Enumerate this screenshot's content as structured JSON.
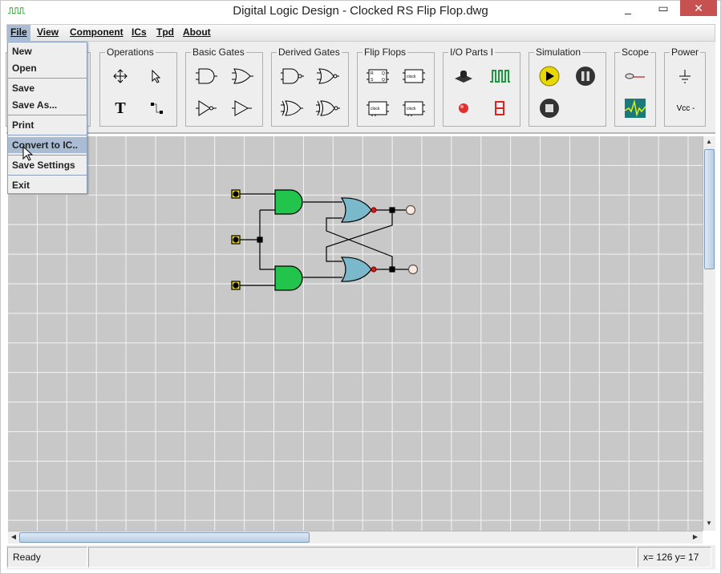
{
  "window": {
    "title": "Digital Logic Design - Clocked RS Flip Flop.dwg",
    "minimize": "—",
    "maximize": "□",
    "close": "✕",
    "app_icon": "clock-pulse-icon"
  },
  "menubar": [
    "File",
    "View",
    "Component",
    "ICs",
    "Tpd",
    "About"
  ],
  "file_menu": {
    "items": [
      "New",
      "Open",
      "Save",
      "Save As...",
      "Print",
      "Convert to IC..",
      "Save Settings",
      "Exit"
    ],
    "highlighted": "Convert to IC.."
  },
  "toolbar": {
    "groups": [
      {
        "label": "Operations",
        "tools": [
          "move-icon",
          "select-pointer-icon",
          "text-icon",
          "wire-icon"
        ]
      },
      {
        "label": "Basic Gates",
        "tools": [
          "and-gate-icon",
          "or-gate-icon",
          "not-gate-icon",
          "buffer-gate-icon"
        ]
      },
      {
        "label": "Derived Gates",
        "tools": [
          "nand-gate-icon",
          "nor-gate-icon",
          "xor-gate-icon",
          "xnor-gate-icon"
        ]
      },
      {
        "label": "Flip Flops",
        "tools": [
          "rs-flipflop-icon",
          "jk-flipflop-icon",
          "d-flipflop-icon",
          "t-flipflop-icon"
        ]
      },
      {
        "label": "I/O Parts I",
        "tools": [
          "push-button-icon",
          "clock-icon",
          "led-icon",
          "seven-segment-icon"
        ]
      },
      {
        "label": "Simulation",
        "tools": [
          "play-icon",
          "pause-icon",
          "stop-icon"
        ]
      },
      {
        "label": "Scope",
        "tools": [
          "probe-icon",
          "oscilloscope-icon"
        ]
      },
      {
        "label": "Power",
        "tools": [
          "ground-icon",
          "vcc-icon"
        ],
        "vcc_label": "Vcc -"
      }
    ]
  },
  "colors": {
    "and_gate": "#22c44c",
    "nor_gate": "#7ab8cc",
    "input": "#f5e000",
    "bubble": "#cc2222",
    "output": "#fde9dc",
    "menu_highlight": "#a9bcd3"
  },
  "status": {
    "message": "Ready",
    "coords": "x= 126  y= 17"
  }
}
